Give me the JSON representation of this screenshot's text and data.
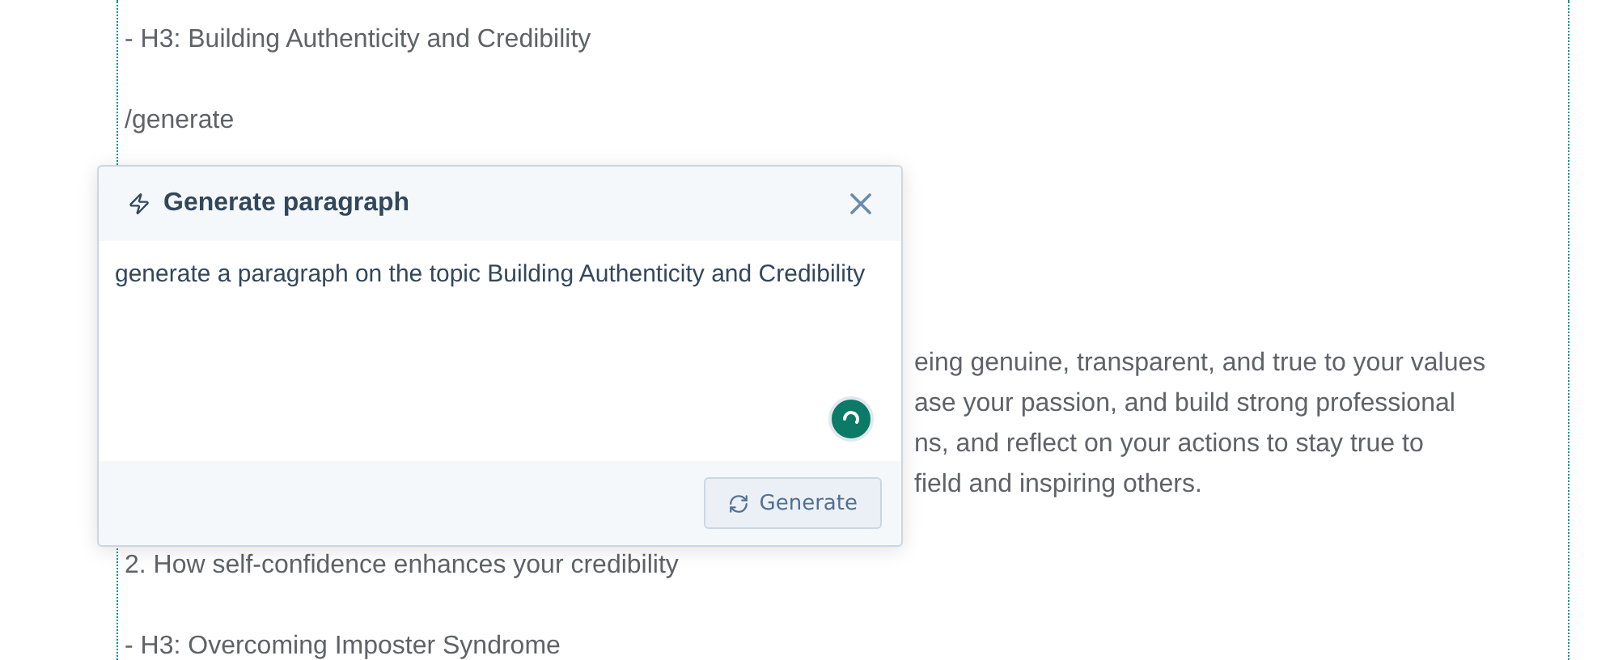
{
  "editor": {
    "blocks": [
      {
        "kind": "line",
        "text": "- H3: Building Authenticity and Credibility"
      },
      {
        "kind": "line",
        "text": "/generate"
      },
      {
        "kind": "paragraph",
        "lines": [
          "eing genuine, transparent, and true to your values",
          "ase your passion, and build strong professional",
          "ns, and reflect on your actions to stay true to",
          "field and inspiring others."
        ]
      },
      {
        "kind": "line",
        "text": "2. How self-confidence enhances your credibility"
      },
      {
        "kind": "line",
        "text": "- H3: Overcoming Imposter Syndrome"
      }
    ]
  },
  "dialog": {
    "title": "Generate paragraph",
    "prompt": "generate a paragraph on the topic Building Authenticity and Credibility",
    "loading": true,
    "button": "Generate"
  }
}
